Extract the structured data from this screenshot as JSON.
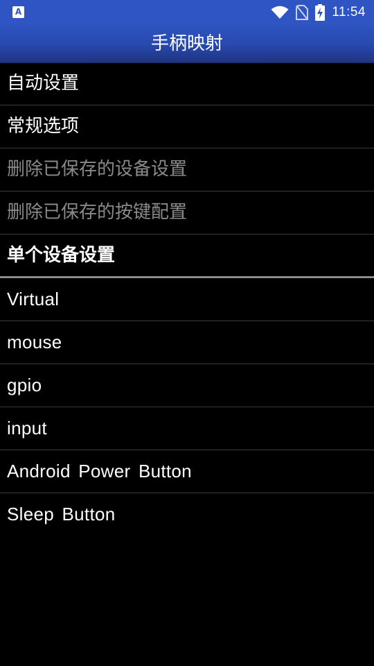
{
  "status_bar": {
    "app_icon_letter": "A",
    "time": "11:54",
    "icons": [
      "wifi-icon",
      "no-sim-icon",
      "battery-charging-icon"
    ]
  },
  "title_bar": {
    "title": "手柄映射"
  },
  "menu": {
    "items": [
      {
        "label": "自动设置",
        "state": "enabled"
      },
      {
        "label": "常规选项",
        "state": "enabled"
      },
      {
        "label": "删除已保存的设备设置",
        "state": "disabled"
      },
      {
        "label": "删除已保存的按键配置",
        "state": "disabled"
      }
    ],
    "section_header": "单个设备设置",
    "devices": [
      {
        "label": "Virtual"
      },
      {
        "label": "mouse"
      },
      {
        "label": "gpio"
      },
      {
        "label": "input"
      },
      {
        "label": "Android Power Button"
      },
      {
        "label": "Sleep Button"
      }
    ]
  },
  "colors": {
    "status_bar": "#2f55c4",
    "title_bar": "#2848ac",
    "background": "#000000",
    "disabled_text": "#8a8a8a",
    "divider": "#3a3a3a"
  }
}
